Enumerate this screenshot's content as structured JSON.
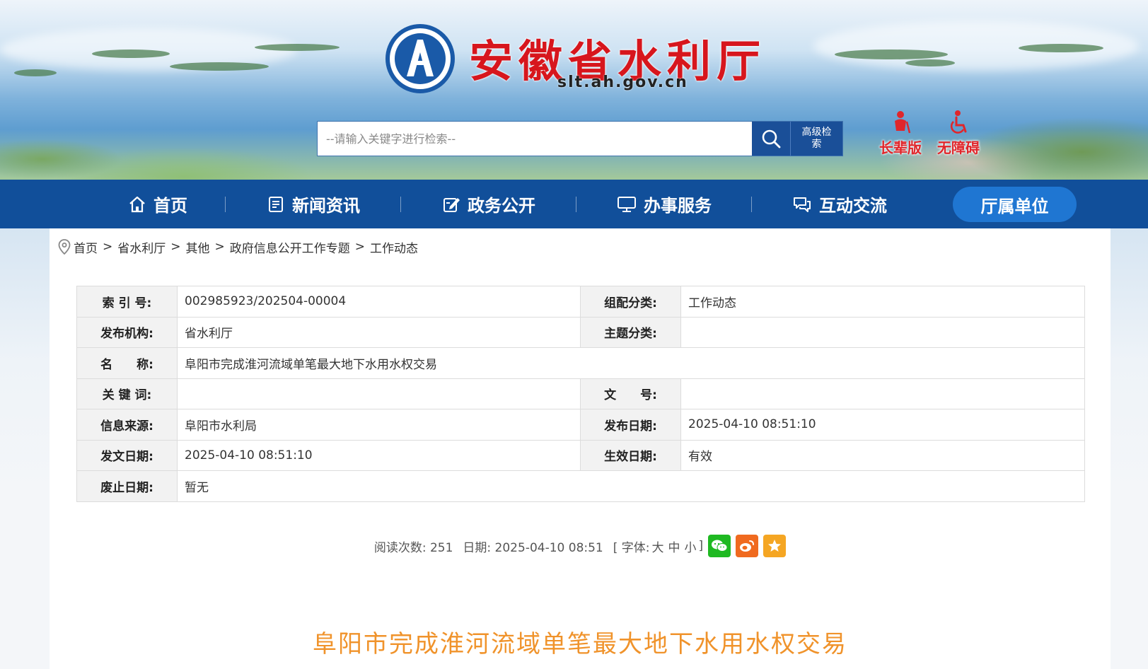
{
  "header": {
    "site_title": "安徽省水利厅",
    "domain": "slt.ah.gov.cn",
    "search_placeholder": "--请输入关键字进行检索--",
    "advanced_search_label": "高级检索",
    "quick_links": [
      {
        "label": "长辈版",
        "icon": "elder-icon"
      },
      {
        "label": "无障碍",
        "icon": "wheelchair-icon"
      }
    ]
  },
  "nav": {
    "items": [
      {
        "label": "首页",
        "icon": "home-icon"
      },
      {
        "label": "新闻资讯",
        "icon": "news-icon"
      },
      {
        "label": "政务公开",
        "icon": "edit-icon"
      },
      {
        "label": "办事服务",
        "icon": "monitor-icon"
      },
      {
        "label": "互动交流",
        "icon": "chat-icon"
      },
      {
        "label": "厅属单位",
        "icon": ""
      }
    ],
    "active": "厅属单位",
    "active_color": "#1f76d2",
    "bar_color": "#114f9a"
  },
  "breadcrumb": [
    "首页",
    "省水利厅",
    "其他",
    "政府信息公开工作专题",
    "工作动态"
  ],
  "info": {
    "index_no_label": "索 引 号:",
    "index_no": "002985923/202504-00004",
    "category_label": "组配分类:",
    "category": "工作动态",
    "publisher_label": "发布机构:",
    "publisher": "省水利厅",
    "topic_label": "主题分类:",
    "topic": "",
    "name_label": "名　　称:",
    "name": "阜阳市完成淮河流域单笔最大地下水用水权交易",
    "keywords_label": "关 键 词:",
    "keywords": "",
    "doc_no_label": "文　　号:",
    "doc_no": "",
    "source_label": "信息来源:",
    "source": "阜阳市水利局",
    "publish_date_label": "发布日期:",
    "publish_date": "2025-04-10 08:51:10",
    "issue_date_label": "发文日期:",
    "issue_date": "2025-04-10 08:51:10",
    "effective_label": "生效日期:",
    "effective": "有效",
    "expiry_label": "废止日期:",
    "expiry": "暂无"
  },
  "meta": {
    "views": "阅读次数: 251",
    "date": "日期: 2025-04-10 08:51",
    "font_prefix": "[ 字体:",
    "font_large": "大",
    "font_medium": "中",
    "font_small": "小",
    "font_suffix": "]",
    "share": [
      {
        "name": "wechat-icon",
        "color": "#1fb922"
      },
      {
        "name": "weibo-icon",
        "color": "#f06a1f"
      },
      {
        "name": "favorite-icon",
        "color": "#f5a623"
      }
    ]
  },
  "article": {
    "title": "阜阳市完成淮河流域单笔最大地下水用水权交易",
    "title_color": "#f0932b"
  }
}
